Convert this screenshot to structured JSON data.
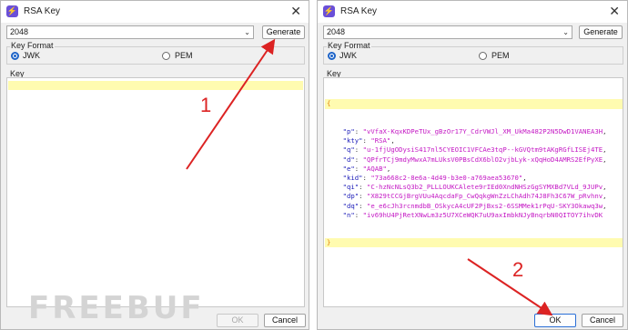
{
  "dialogs": [
    {
      "title": "RSA Key",
      "key_size": "2048",
      "generate_label": "Generate",
      "key_format_label": "Key Format",
      "format_options": [
        "JWK",
        "PEM"
      ],
      "selected_format": "JWK",
      "key_label": "Key",
      "ok_label": "OK",
      "cancel_label": "Cancel",
      "ok_enabled": false
    },
    {
      "title": "RSA Key",
      "key_size": "2048",
      "generate_label": "Generate",
      "key_format_label": "Key Format",
      "format_options": [
        "JWK",
        "PEM"
      ],
      "selected_format": "JWK",
      "key_label": "Key",
      "ok_label": "OK",
      "cancel_label": "Cancel",
      "ok_enabled": true,
      "jwk_open": "{",
      "jwk_close": "}",
      "jwk_fields": [
        {
          "key": "\"p\"",
          "value": "\"vVfaX-KqxKDPeTUx_gBzOr17Y_CdrVWJl_XM_UkMa482P2N5DwD1VANEA3H"
        },
        {
          "key": "\"kty\"",
          "value": "\"RSA\""
        },
        {
          "key": "\"q\"",
          "value": "\"u-1fjUgODysiS417nl5CYEOIC1VFCAe3tqP--kGVQtm9tAKgRGfLISEj4TE"
        },
        {
          "key": "\"d\"",
          "value": "\"QPfrTCj9mdyMwxA7mLUksV0PBsCdX6blO2vjbLyk-xQqHoD4AMRS2EfPyXE"
        },
        {
          "key": "\"e\"",
          "value": "\"AQAB\""
        },
        {
          "key": "\"kid\"",
          "value": "\"73a668c2-8e6a-4d49-b3e0-a769aea53670\""
        },
        {
          "key": "\"qi\"",
          "value": "\"C-hzNcNLsQ3b2_PLLLOUKCAlete9rIEd0XndNHSzGgSYMXBd7VLd_9JUPv"
        },
        {
          "key": "\"dp\"",
          "value": "\"X829tCCGjBrgVUu4AqcdaFp_CwQqkgWnZzLChAdh74J8Fh3C67W_pRvhnv"
        },
        {
          "key": "\"dq\"",
          "value": "\"e_e6cJh3rcnmdbB_OSkycA4cUF2PjBxs2-6SSMMek1rPqU-SKY3Okawq3w"
        },
        {
          "key": "\"n\"",
          "value": "\"iv69hU4PjRetXNwLm3z5U7XCeWQK7uU9axImbkNJyBnqrbN0QITOY7ihvDK"
        }
      ]
    }
  ],
  "annotations": {
    "step1": "1",
    "step2": "2",
    "watermark": "FREEBUF",
    "arrow_color": "#dc2323"
  }
}
